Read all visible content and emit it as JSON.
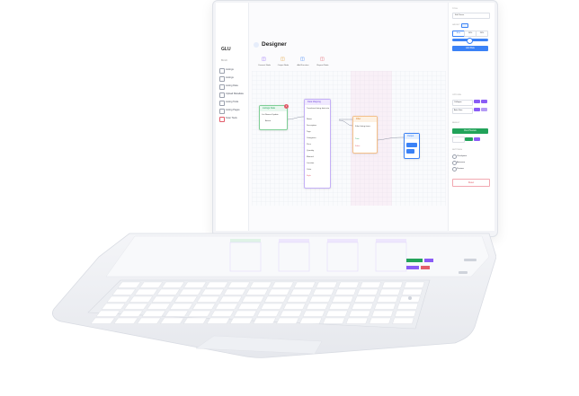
{
  "app": {
    "logo": "GLU",
    "title": "Designer",
    "sidebar_heading": "BUILD",
    "sidebar_items": [
      "Listings",
      "Listings",
      "Listing Data",
      "Upload Metadata",
      "Listing Tools",
      "Listing Pages",
      "Scan Tools"
    ]
  },
  "toolbar": {
    "buttons": [
      {
        "label": "Connect Node",
        "color": "#8a5cf6"
      },
      {
        "label": "Output Node",
        "color": "#e2a23a"
      },
      {
        "label": "Add Function",
        "color": "#3b82f6"
      },
      {
        "label": "Repeat Node",
        "color": "#e35d6a"
      }
    ]
  },
  "canvas": {
    "source_node": {
      "title": "Listings Data",
      "subtitle": "List Names Update",
      "row": "Action",
      "badge": "1"
    },
    "middle_node": {
      "title": "Data Mapping",
      "subtitle": "Transform listing data into a new",
      "rows": [
        "Name",
        "Description",
        "Tags",
        "Categories",
        "Price",
        "Quantity",
        "Material",
        "Location",
        "Color",
        "Style"
      ]
    },
    "filter_node": {
      "title": "Filter",
      "subtitle": "Filter listing items",
      "rows": [
        "True",
        "False"
      ]
    },
    "output_node": {
      "title": "Output"
    }
  },
  "properties": {
    "heading": "TITLE",
    "field_value": "Edit Name",
    "layout_label": "LAYOUT",
    "layout_values": [
      "Auto",
      "10%",
      "20%"
    ],
    "action_button": "Add Rule",
    "options_label": "OPTIONS",
    "option_values": [
      "Collapse",
      "Auto Size"
    ],
    "result_label": "RESULT",
    "result_button": "Run Preview",
    "settings_label": "SETTINGS",
    "checkboxes": [
      "Checkpoint",
      "Autosave",
      "Preview"
    ],
    "footer_button": "Reset"
  },
  "colors": {
    "accent_purple": "#8a5cf6",
    "accent_blue": "#3b82f6",
    "accent_green": "#22a35a",
    "accent_orange": "#f0a04b",
    "accent_red": "#e25c6b"
  }
}
